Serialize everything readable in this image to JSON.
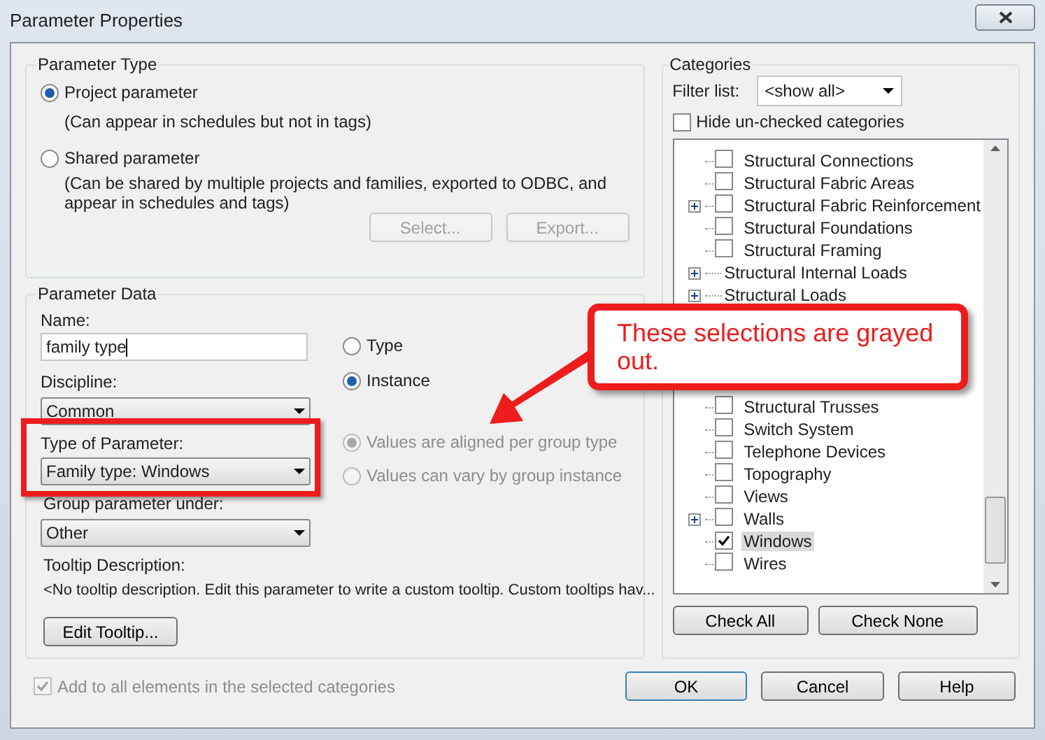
{
  "window": {
    "title": "Parameter Properties"
  },
  "parameter_type": {
    "title": "Parameter Type",
    "options": [
      {
        "label": "Project parameter",
        "description": "(Can appear in schedules but not in tags)",
        "selected": true
      },
      {
        "label": "Shared parameter",
        "description": "(Can be shared by multiple projects and families, exported to ODBC, and appear in schedules and tags)",
        "selected": false
      }
    ],
    "buttons": [
      {
        "label": "Select...",
        "disabled": true
      },
      {
        "label": "Export...",
        "disabled": true
      }
    ]
  },
  "parameter_data": {
    "title": "Parameter Data",
    "name_label": "Name:",
    "name_value": "family type",
    "discipline_label": "Discipline:",
    "discipline_value": "Common",
    "type_label": "Type of Parameter:",
    "type_value": "Family type: Windows",
    "group_label": "Group parameter under:",
    "group_value": "Other",
    "tooltip_label": "Tooltip Description:",
    "tooltip_text": "<No tooltip description. Edit this parameter to write a custom tooltip. Custom tooltips hav...",
    "edit_tooltip_button": "Edit Tooltip...",
    "scope_options": [
      {
        "label": "Type",
        "selected": false
      },
      {
        "label": "Instance",
        "selected": true
      }
    ],
    "group_options": [
      {
        "label": "Values are aligned per group type",
        "selected": true,
        "disabled": true
      },
      {
        "label": "Values can vary by group instance",
        "selected": false,
        "disabled": true
      }
    ]
  },
  "add_to_all": {
    "label": "Add to all elements in the selected categories",
    "checked": true,
    "disabled": true
  },
  "categories": {
    "title": "Categories",
    "filter_label": "Filter list:",
    "filter_value": "<show all>",
    "hide_unchecked": {
      "label": "Hide un-checked categories",
      "checked": false
    },
    "upper_items": [
      {
        "label": "Structural Connections",
        "kind": "checkbox",
        "expandable": false,
        "checked": false,
        "selected": false
      },
      {
        "label": "Structural Fabric Areas",
        "kind": "checkbox",
        "expandable": false,
        "checked": false,
        "selected": false
      },
      {
        "label": "Structural Fabric Reinforcement",
        "kind": "checkbox",
        "expandable": true,
        "checked": false,
        "selected": false
      },
      {
        "label": "Structural Foundations",
        "kind": "checkbox",
        "expandable": false,
        "checked": false,
        "selected": false
      },
      {
        "label": "Structural Framing",
        "kind": "checkbox",
        "expandable": false,
        "checked": false,
        "selected": false
      },
      {
        "label": "Structural Internal Loads",
        "kind": "group",
        "expandable": true,
        "selected": false
      },
      {
        "label": "Structural Loads",
        "kind": "group",
        "expandable": true,
        "selected": false
      }
    ],
    "lower_items": [
      {
        "label": "Structural Trusses",
        "kind": "checkbox",
        "expandable": false,
        "checked": false,
        "selected": false
      },
      {
        "label": "Switch System",
        "kind": "checkbox",
        "expandable": false,
        "checked": false,
        "selected": false
      },
      {
        "label": "Telephone Devices",
        "kind": "checkbox",
        "expandable": false,
        "checked": false,
        "selected": false
      },
      {
        "label": "Topography",
        "kind": "checkbox",
        "expandable": false,
        "checked": false,
        "selected": false
      },
      {
        "label": "Views",
        "kind": "checkbox",
        "expandable": false,
        "checked": false,
        "selected": false
      },
      {
        "label": "Walls",
        "kind": "checkbox",
        "expandable": true,
        "checked": false,
        "selected": false
      },
      {
        "label": "Windows",
        "kind": "checkbox",
        "expandable": false,
        "checked": true,
        "selected": true
      },
      {
        "label": "Wires",
        "kind": "checkbox",
        "expandable": false,
        "checked": false,
        "selected": false
      }
    ],
    "buttons": [
      "Check All",
      "Check None"
    ]
  },
  "buttons": [
    "OK",
    "Cancel",
    "Help"
  ],
  "callout": {
    "text": "These selections are grayed out."
  }
}
